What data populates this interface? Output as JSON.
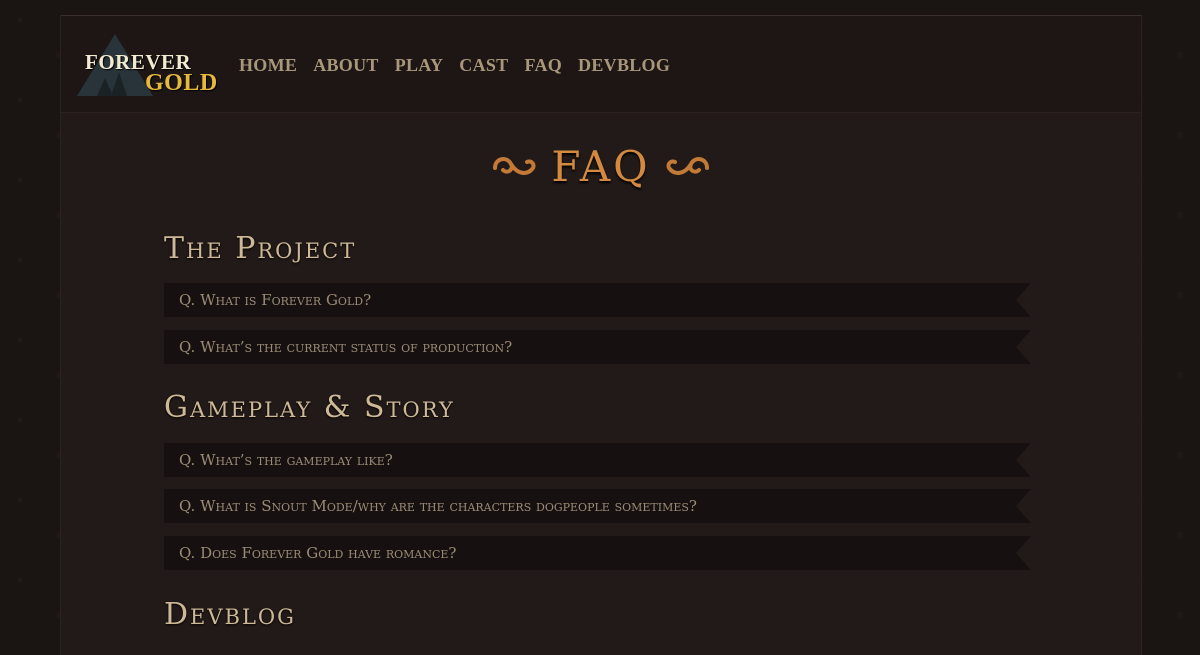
{
  "brand": {
    "line1": "FOREVER",
    "line2": "GOLD"
  },
  "nav": {
    "items": [
      {
        "label": "HOME"
      },
      {
        "label": "ABOUT"
      },
      {
        "label": "PLAY"
      },
      {
        "label": "CAST"
      },
      {
        "label": "FAQ"
      },
      {
        "label": "DEVBLOG"
      }
    ]
  },
  "page": {
    "title": "FAQ"
  },
  "sections": [
    {
      "heading": "The Project",
      "questions": [
        "Q. What is Forever Gold?",
        "Q. What’s the current status of production?"
      ]
    },
    {
      "heading": "Gameplay & Story",
      "questions": [
        "Q. What’s the gameplay like?",
        "Q. What is Snout Mode/why are the characters dogpeople sometimes?",
        "Q. Does Forever Gold have romance?"
      ]
    },
    {
      "heading": "Devblog",
      "questions": []
    }
  ],
  "colors": {
    "background": "#1a1413",
    "content": "#221a18",
    "header": "#1d1615",
    "nav_text": "#a8977a",
    "title_accent": "#d3893f",
    "heading_text": "#cdb997",
    "question_bar": "#161110",
    "question_text": "#9b8b76",
    "logo_white": "#f3ead2",
    "logo_gold": "#e6b93c"
  },
  "icons": {
    "logo": "forest-triangle-emblem",
    "title_ornament_left": "swirl-ornament-icon",
    "title_ornament_right": "swirl-ornament-icon"
  }
}
